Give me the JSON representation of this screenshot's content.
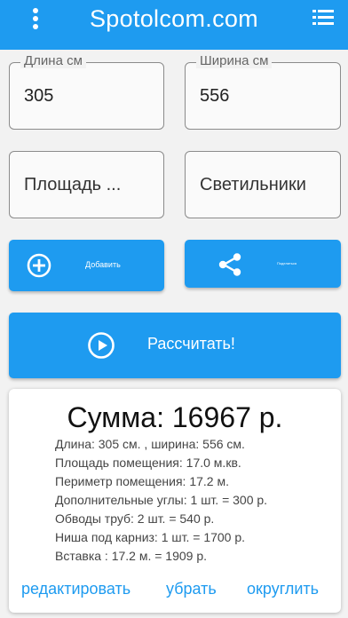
{
  "appbar": {
    "title": "Spotolcom.com",
    "menu_icon": "more-vert-icon",
    "list_icon": "list-icon",
    "color": "#1e9bf0"
  },
  "fields": {
    "length": {
      "label": "Длина см",
      "value": "305"
    },
    "width": {
      "label": "Ширина см",
      "value": "556"
    },
    "area": {
      "placeholder": "Площадь ..."
    },
    "lights": {
      "placeholder": "Светильники"
    }
  },
  "buttons": {
    "add": {
      "label": "Добавить",
      "icon": "add-circle-icon"
    },
    "share": {
      "label": "Поделиться",
      "icon": "share-icon"
    },
    "calculate": {
      "label": "Рассчитать!",
      "icon": "play-circle-icon"
    }
  },
  "result": {
    "sum": "Сумма: 16967 р.",
    "details": [
      "Длина: 305 см. , ширина: 556 см.",
      "Площадь помещения: 17.0 м.кв.",
      "Периметр помещения: 17.2 м.",
      "Дополнительные углы:  1 шт. = 300  р.",
      "Обводы труб: 2 шт. = 540  р.",
      "Ниша под карниз: 1 шт. = 1700  р.",
      "Вставка : 17.2 м. = 1909 р."
    ],
    "links": {
      "edit": "редактировать",
      "remove": "убрать",
      "round": "округлить"
    }
  }
}
